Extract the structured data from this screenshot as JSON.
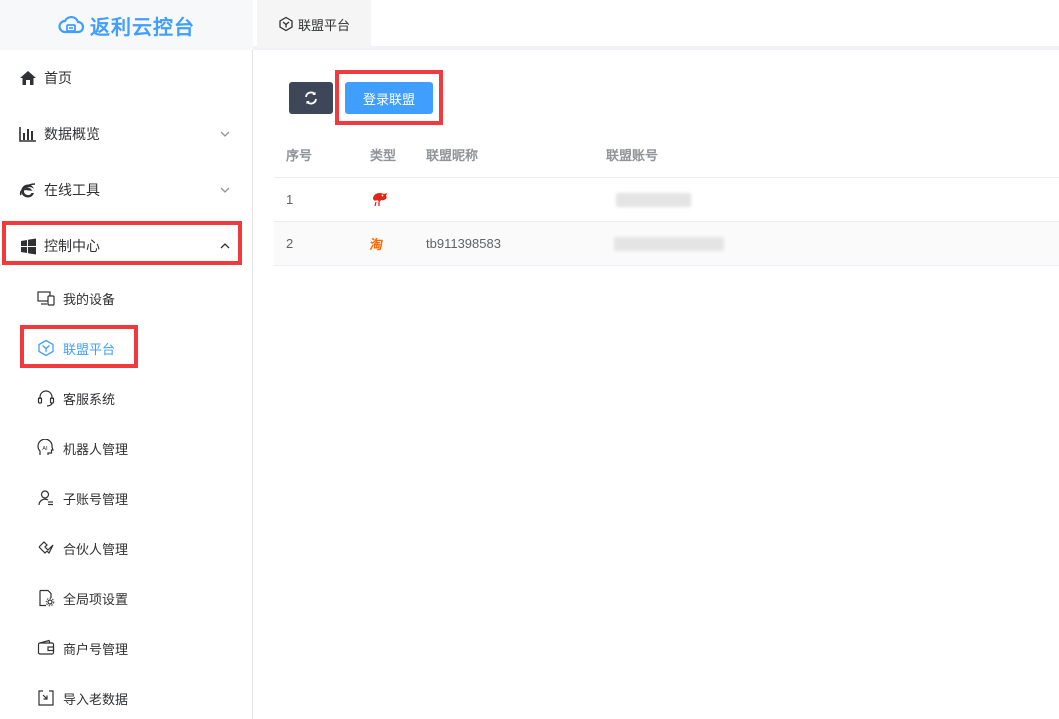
{
  "app": {
    "title": "返利云控台",
    "brand_color": "#409eff"
  },
  "top_tab": {
    "label": "联盟平台",
    "icon": "cube-icon"
  },
  "sidebar": {
    "menu": [
      {
        "label": "首页",
        "icon": "home-icon"
      },
      {
        "label": "数据概览",
        "icon": "bar-chart-icon",
        "expanded": false
      },
      {
        "label": "在线工具",
        "icon": "ie-icon",
        "expanded": false
      },
      {
        "label": "控制中心",
        "icon": "windows-icon",
        "expanded": true
      }
    ],
    "submenu": [
      {
        "label": "我的设备",
        "icon": "devices-icon"
      },
      {
        "label": "联盟平台",
        "icon": "cube-icon",
        "active": true
      },
      {
        "label": "客服系统",
        "icon": "headset-icon"
      },
      {
        "label": "机器人管理",
        "icon": "ai-icon"
      },
      {
        "label": "子账号管理",
        "icon": "user-list-icon"
      },
      {
        "label": "合伙人管理",
        "icon": "handshake-icon"
      },
      {
        "label": "全局项设置",
        "icon": "file-gear-icon"
      },
      {
        "label": "商户号管理",
        "icon": "wallet-icon"
      },
      {
        "label": "导入老数据",
        "icon": "import-icon"
      }
    ]
  },
  "toolbar": {
    "refresh_icon": "refresh-icon",
    "login_label": "登录联盟"
  },
  "table": {
    "headers": [
      "序号",
      "类型",
      "联盟昵称",
      "联盟账号"
    ],
    "rows": [
      {
        "index": "1",
        "type_icon": "jd-icon",
        "nickname": "",
        "account": ""
      },
      {
        "index": "2",
        "type_icon": "taobao-icon",
        "type_text": "淘",
        "nickname": "tb911398583",
        "account": ""
      }
    ]
  },
  "highlight_color": "#f03a3e"
}
